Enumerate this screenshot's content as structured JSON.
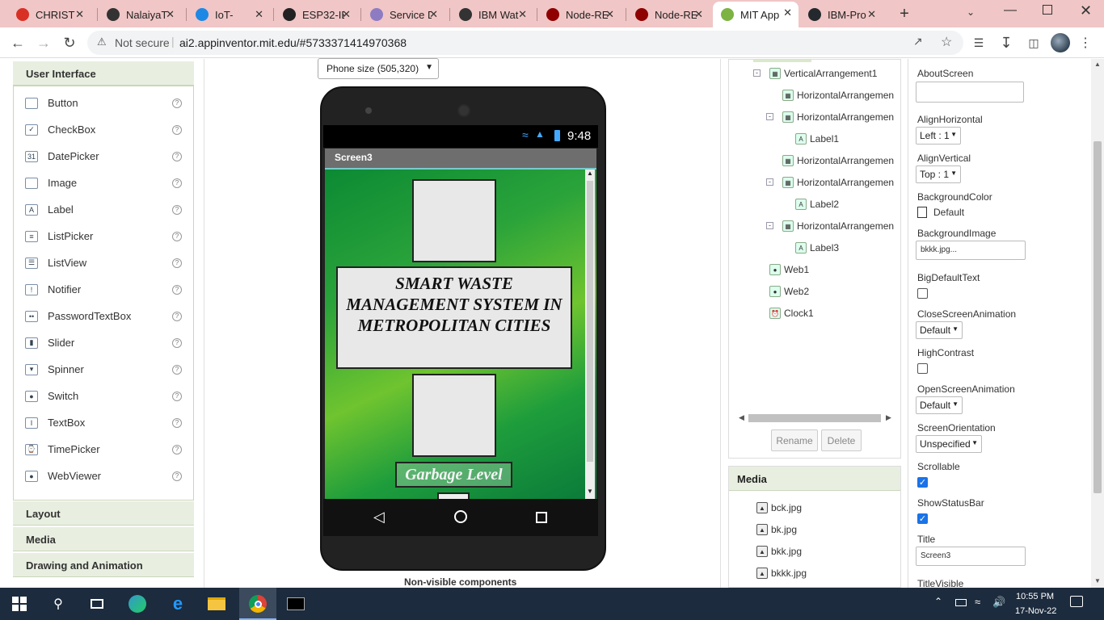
{
  "browser": {
    "tabs": [
      {
        "title": "CHRIST",
        "color": "#d93025"
      },
      {
        "title": "NalaiyaT",
        "color": "#333333"
      },
      {
        "title": "IoT-",
        "color": "#1e88e5"
      },
      {
        "title": "ESP32-IE",
        "color": "#222222"
      },
      {
        "title": "Service D",
        "color": "#8e7cc3"
      },
      {
        "title": "IBM Wat",
        "color": "#333333"
      },
      {
        "title": "Node-RE",
        "color": "#8f0000"
      },
      {
        "title": "Node-RE",
        "color": "#8f0000"
      },
      {
        "title": "MIT App",
        "color": "#7cb342"
      },
      {
        "title": "IBM-Pro",
        "color": "#24292e"
      }
    ],
    "active_tab": 8,
    "security": "Not secure",
    "url": "ai2.appinventor.mit.edu/#5733371414970368"
  },
  "palette": {
    "user_interface_label": "User Interface",
    "items": [
      {
        "label": "Button",
        "icon": "button-icon"
      },
      {
        "label": "CheckBox",
        "icon": "checkbox-icon"
      },
      {
        "label": "DatePicker",
        "icon": "datepicker-icon"
      },
      {
        "label": "Image",
        "icon": "image-icon"
      },
      {
        "label": "Label",
        "icon": "label-icon"
      },
      {
        "label": "ListPicker",
        "icon": "listpicker-icon"
      },
      {
        "label": "ListView",
        "icon": "listview-icon"
      },
      {
        "label": "Notifier",
        "icon": "notifier-icon"
      },
      {
        "label": "PasswordTextBox",
        "icon": "password-icon"
      },
      {
        "label": "Slider",
        "icon": "slider-icon"
      },
      {
        "label": "Spinner",
        "icon": "spinner-icon"
      },
      {
        "label": "Switch",
        "icon": "switch-icon"
      },
      {
        "label": "TextBox",
        "icon": "textbox-icon"
      },
      {
        "label": "TimePicker",
        "icon": "timepicker-icon"
      },
      {
        "label": "WebViewer",
        "icon": "webviewer-icon"
      }
    ],
    "help": "?",
    "categories": [
      "Layout",
      "Media",
      "Drawing and Animation"
    ]
  },
  "viewer": {
    "phone_size": "Phone size (505,320)",
    "status_time": "9:48",
    "screen_title": "Screen3",
    "heading_text": "SMART WASTE MANAGEMENT SYSTEM IN METROPOLITAN CITIES",
    "garbage_label": "Garbage Level",
    "nonvisible_label": "Non-visible components"
  },
  "components": {
    "tree": [
      {
        "label": "VerticalArrangement1",
        "level": 0
      },
      {
        "label": "HorizontalArrangemen",
        "level": 1
      },
      {
        "label": "HorizontalArrangemen",
        "level": 1
      },
      {
        "label": "Label1",
        "level": 2
      },
      {
        "label": "HorizontalArrangemen",
        "level": 1
      },
      {
        "label": "HorizontalArrangemen",
        "level": 1
      },
      {
        "label": "Label2",
        "level": 2
      },
      {
        "label": "HorizontalArrangemen",
        "level": 1
      },
      {
        "label": "Label3",
        "level": 2
      },
      {
        "label": "Web1",
        "level": 0
      },
      {
        "label": "Web2",
        "level": 0
      },
      {
        "label": "Clock1",
        "level": 0
      }
    ],
    "rename_label": "Rename",
    "delete_label": "Delete"
  },
  "media": {
    "title": "Media",
    "files": [
      "bck.jpg",
      "bk.jpg",
      "bkk.jpg",
      "bkkk.jpg"
    ]
  },
  "properties": {
    "about_screen_label": "AboutScreen",
    "align_horizontal_label": "AlignHorizontal",
    "align_horizontal_value": "Left : 1",
    "align_vertical_label": "AlignVertical",
    "align_vertical_value": "Top : 1",
    "background_color_label": "BackgroundColor",
    "background_color_value": "Default",
    "background_image_label": "BackgroundImage",
    "background_image_value": "bkkk.jpg...",
    "big_default_text_label": "BigDefaultText",
    "close_screen_animation_label": "CloseScreenAnimation",
    "close_screen_animation_value": "Default",
    "high_contrast_label": "HighContrast",
    "open_screen_animation_label": "OpenScreenAnimation",
    "open_screen_animation_value": "Default",
    "screen_orientation_label": "ScreenOrientation",
    "screen_orientation_value": "Unspecified",
    "scrollable_label": "Scrollable",
    "scrollable_checked": true,
    "show_status_bar_label": "ShowStatusBar",
    "show_status_bar_checked": true,
    "title_label": "Title",
    "title_value": "Screen3",
    "title_visible_label": "TitleVisible"
  },
  "taskbar": {
    "time": "10:55 PM",
    "date": "17-Nov-22"
  }
}
